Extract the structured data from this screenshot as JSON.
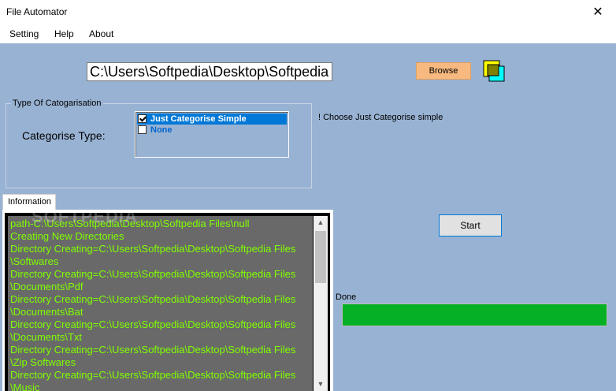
{
  "window": {
    "title": "File Automator",
    "close_glyph": "✕"
  },
  "menu": {
    "items": [
      "Setting",
      "Help",
      "About"
    ]
  },
  "path_input": {
    "value": "C:\\Users\\Softpedia\\Desktop\\Softpedia Files"
  },
  "browse": {
    "label": "Browse",
    "color": "#f7b97f"
  },
  "corner_icon": {
    "name": "color-swatch-icon",
    "colors": [
      "#ffff00",
      "#00ffff",
      "#808000"
    ]
  },
  "categorisation": {
    "group_title": "Type Of Catogarisation",
    "label": "Categorise Type:",
    "options": [
      {
        "label": "Just Categorise Simple",
        "checked": true,
        "selected": true
      },
      {
        "label": "None",
        "checked": false,
        "selected": false
      }
    ],
    "hint": "! Choose Just Categorise simple"
  },
  "information": {
    "tab_label": "Information",
    "log_lines": [
      "path-C:\\Users\\Softpedia\\Desktop\\Softpedia Files\\null",
      "Creating New Directories",
      "Directory Creating=C:\\Users\\Softpedia\\Desktop\\Softpedia Files",
      "\\Softwares",
      "Directory Creating=C:\\Users\\Softpedia\\Desktop\\Softpedia Files",
      "\\Documents\\Pdf",
      "Directory Creating=C:\\Users\\Softpedia\\Desktop\\Softpedia Files",
      "\\Documents\\Bat",
      "Directory Creating=C:\\Users\\Softpedia\\Desktop\\Softpedia Files",
      "\\Documents\\Txt",
      "Directory Creating=C:\\Users\\Softpedia\\Desktop\\Softpedia Files",
      "\\Zip Softwares",
      "Directory Creating=C:\\Users\\Softpedia\\Desktop\\Softpedia Files",
      "\\Music"
    ],
    "log_color": "#7fff00"
  },
  "start": {
    "label": "Start"
  },
  "progress": {
    "label": "Done",
    "fraction": 1.0,
    "color": "#06b025"
  },
  "watermark": "SOFTPEDIA"
}
